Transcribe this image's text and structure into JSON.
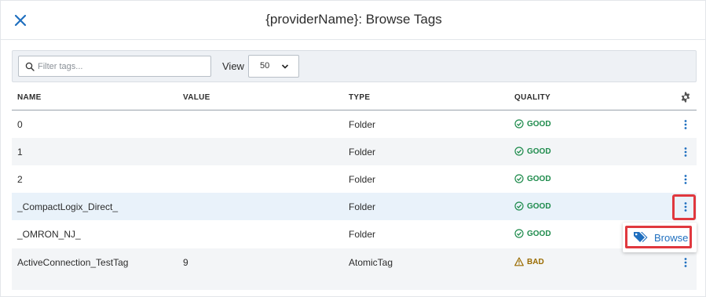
{
  "dialog": {
    "title": "{providerName}: Browse Tags",
    "close_icon": "close-icon"
  },
  "toolbar": {
    "search_placeholder": "Filter tags...",
    "search_value": "",
    "view_label": "View",
    "view_value": "50"
  },
  "table": {
    "columns": [
      "NAME",
      "VALUE",
      "TYPE",
      "QUALITY"
    ],
    "rows": [
      {
        "name": "0",
        "value": "",
        "type": "Folder",
        "quality": "GOOD"
      },
      {
        "name": "1",
        "value": "",
        "type": "Folder",
        "quality": "GOOD"
      },
      {
        "name": "2",
        "value": "",
        "type": "Folder",
        "quality": "GOOD"
      },
      {
        "name": "_CompactLogix_Direct_",
        "value": "",
        "type": "Folder",
        "quality": "GOOD"
      },
      {
        "name": "_OMRON_NJ_",
        "value": "",
        "type": "Folder",
        "quality": "GOOD"
      },
      {
        "name": "ActiveConnection_TestTag",
        "value": "9",
        "type": "AtomicTag",
        "quality": "BAD"
      }
    ]
  },
  "context_menu": {
    "browse_label": "Browse",
    "browse_icon": "tag-icon"
  },
  "colors": {
    "good": "#1e8b4c",
    "bad": "#9a6b00",
    "accent": "#1f6fbf",
    "highlight": "#e0383e"
  }
}
